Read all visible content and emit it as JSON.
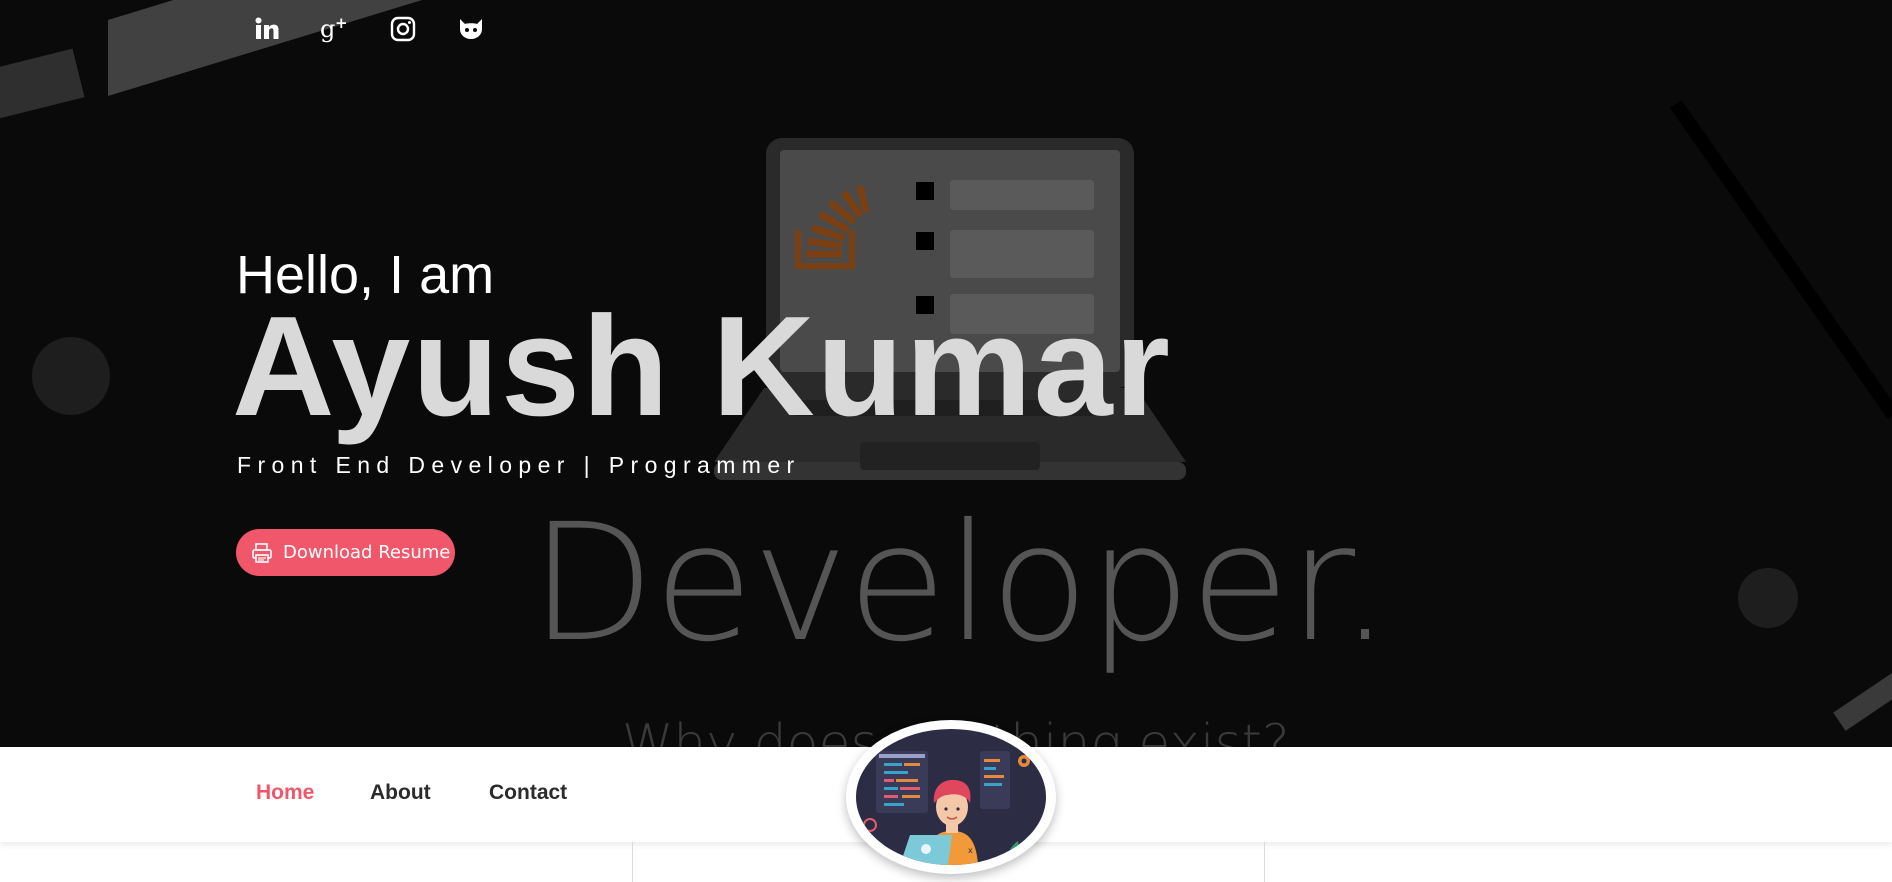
{
  "social": [
    {
      "icon": "linkedin-icon"
    },
    {
      "icon": "google-plus-icon"
    },
    {
      "icon": "instagram-icon"
    },
    {
      "icon": "github-icon"
    }
  ],
  "hero": {
    "greeting": "Hello, I am",
    "name": "Ayush Kumar",
    "role": "Front End Developer | Programmer",
    "download_label": "Download Resume",
    "download_icon": "printer-icon",
    "background_word": "Developer.",
    "background_subtext": "Why does anything exist?"
  },
  "nav": {
    "items": [
      {
        "label": "Home",
        "active": true
      },
      {
        "label": "About",
        "active": false
      },
      {
        "label": "Contact",
        "active": false
      }
    ]
  },
  "colors": {
    "accent": "#f0576a",
    "hero_bg": "#0a0a0a",
    "nav_bg": "#ffffff"
  }
}
